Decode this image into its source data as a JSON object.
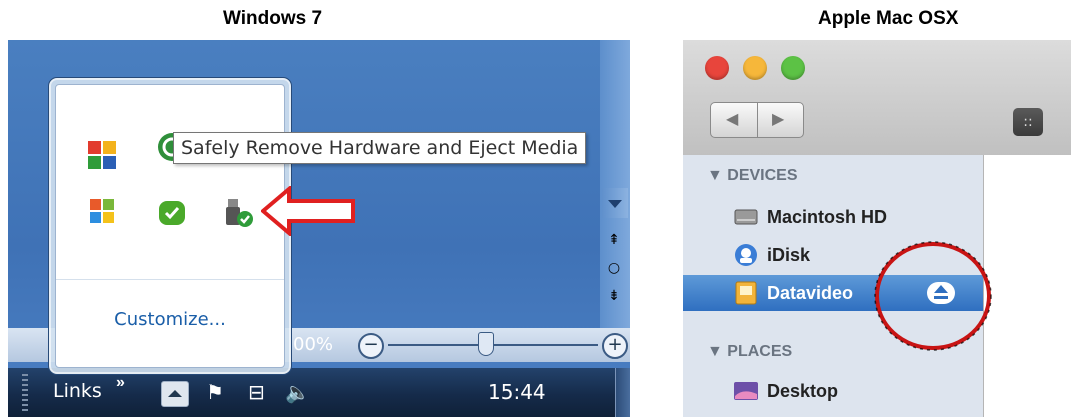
{
  "headings": {
    "windows": "Windows 7",
    "mac": "Apple Mac OSX"
  },
  "windows": {
    "tooltip": "Safely Remove Hardware and Eject Media",
    "customize_label": "Customize...",
    "zoom_text": "00%",
    "taskbar": {
      "links_label": "Links",
      "links_chevron": "»",
      "clock": "15:44"
    },
    "icons": [
      "avg-icon",
      "sync-icon",
      "folder-icon",
      "windows-update-icon",
      "skype-icon",
      "usb-eject-icon",
      "flag-icon",
      "network-icon",
      "volume-icon"
    ]
  },
  "mac": {
    "sections": {
      "devices": "▼ DEVICES",
      "places": "▼ PLACES"
    },
    "devices": [
      {
        "label": "Macintosh HD",
        "icon": "hard-drive-icon"
      },
      {
        "label": "iDisk",
        "icon": "idisk-icon"
      },
      {
        "label": "Datavideo",
        "icon": "drive-icon",
        "selected": true
      }
    ],
    "places": [
      {
        "label": "Desktop",
        "icon": "desktop-icon"
      }
    ],
    "nav": {
      "back": "◀",
      "forward": "▶",
      "view": "::"
    }
  },
  "colors": {
    "win_blue": "#4a7fc0",
    "taskbar": "#152b4a",
    "highlight_red": "#e02020",
    "mac_selection": "#2f6fc0",
    "mac_sidebar": "#dde4ee"
  }
}
